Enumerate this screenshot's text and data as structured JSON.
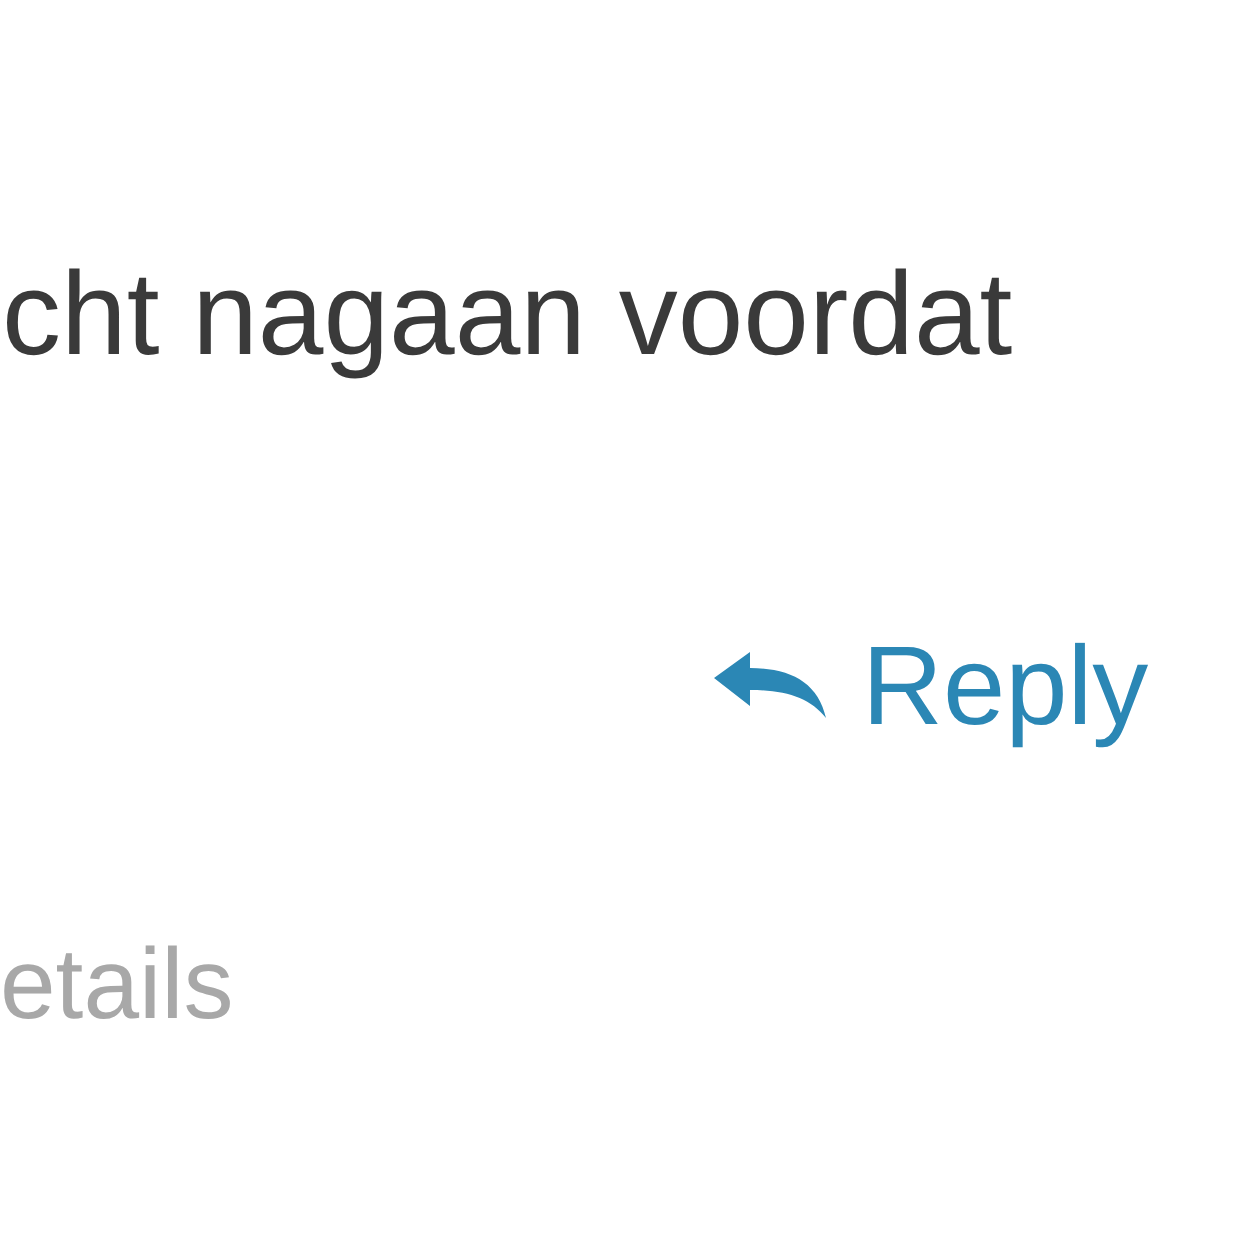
{
  "message": {
    "text": "cht nagaan voordat"
  },
  "reply_link": {
    "label": "Reply"
  },
  "details_link": {
    "label": "etails"
  }
}
